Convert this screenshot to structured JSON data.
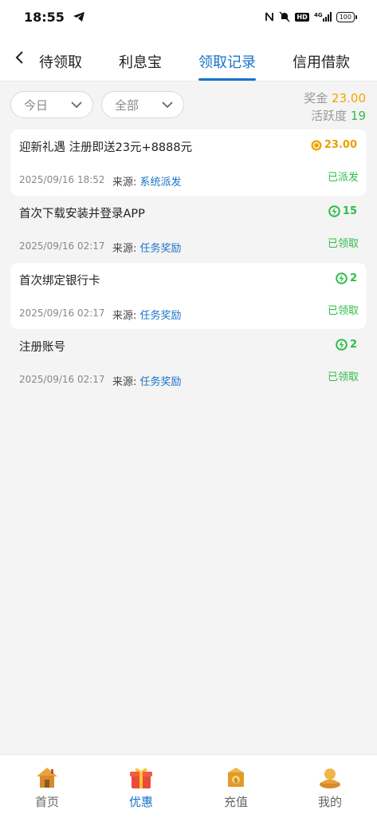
{
  "status_bar": {
    "time": "18:55",
    "network": "4G",
    "battery": "100"
  },
  "tabs": [
    {
      "label": "待领取",
      "active": false
    },
    {
      "label": "利息宝",
      "active": false
    },
    {
      "label": "领取记录",
      "active": true
    },
    {
      "label": "信用借款",
      "active": false
    }
  ],
  "filters": {
    "date_value": "今日",
    "type_value": "全部"
  },
  "summary": {
    "bonus_label": "奖金",
    "bonus_value": "23.00",
    "activity_label": "活跃度",
    "activity_value": "19"
  },
  "records": [
    {
      "title": "迎新礼遇 注册即送23元+8888元",
      "amount": "23.00",
      "amount_type": "coin",
      "date": "2025/09/16 18:52",
      "source_label": "来源:",
      "source": "系统派发",
      "status": "已派发"
    },
    {
      "title": "首次下载安装并登录APP",
      "amount": "15",
      "amount_type": "energy",
      "date": "2025/09/16 02:17",
      "source_label": "来源:",
      "source": "任务奖励",
      "status": "已领取"
    },
    {
      "title": "首次绑定银行卡",
      "amount": "2",
      "amount_type": "energy",
      "date": "2025/09/16 02:17",
      "source_label": "来源:",
      "source": "任务奖励",
      "status": "已领取"
    },
    {
      "title": "注册账号",
      "amount": "2",
      "amount_type": "energy",
      "date": "2025/09/16 02:17",
      "source_label": "来源:",
      "source": "任务奖励",
      "status": "已领取"
    }
  ],
  "bottom_nav": [
    {
      "label": "首页",
      "icon": "home-icon",
      "active": false
    },
    {
      "label": "优惠",
      "icon": "gift-icon",
      "active": true
    },
    {
      "label": "充值",
      "icon": "wallet-icon",
      "active": false
    },
    {
      "label": "我的",
      "icon": "profile-icon",
      "active": false
    }
  ],
  "colors": {
    "accent": "#1a73c9",
    "gold": "#f0a500",
    "green": "#2ebd47"
  }
}
